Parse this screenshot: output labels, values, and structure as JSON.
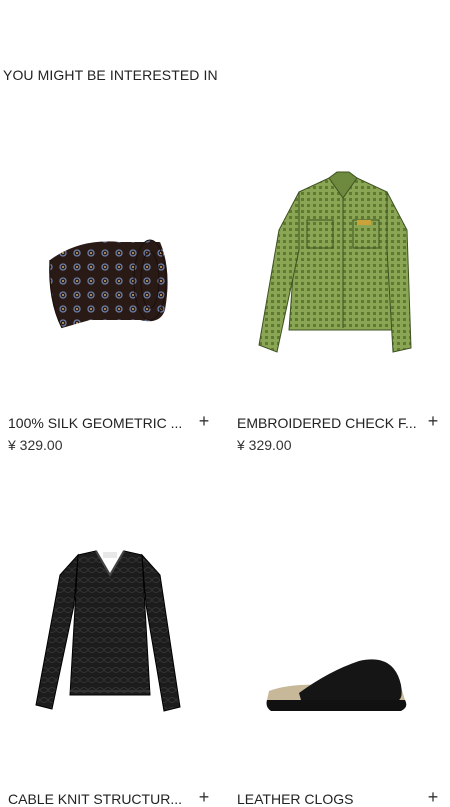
{
  "section_title": "YOU MIGHT BE INTERESTED IN",
  "add_icon": "plus-icon",
  "products": [
    {
      "name": "100% SILK GEOMETRIC ...",
      "price": "¥ 329.00",
      "image": "tie-image"
    },
    {
      "name": "EMBROIDERED CHECK F...",
      "price": "¥ 329.00",
      "image": "check-shirt-image"
    },
    {
      "name": "CABLE KNIT STRUCTUR...",
      "price": "",
      "image": "knit-sweater-image"
    },
    {
      "name": "LEATHER CLOGS",
      "price": "",
      "image": "clogs-image"
    }
  ],
  "colors": {
    "shirt_green": "#7d9a4a",
    "knit_black": "#1c1c1c",
    "tie_base": "#2a1a16"
  }
}
